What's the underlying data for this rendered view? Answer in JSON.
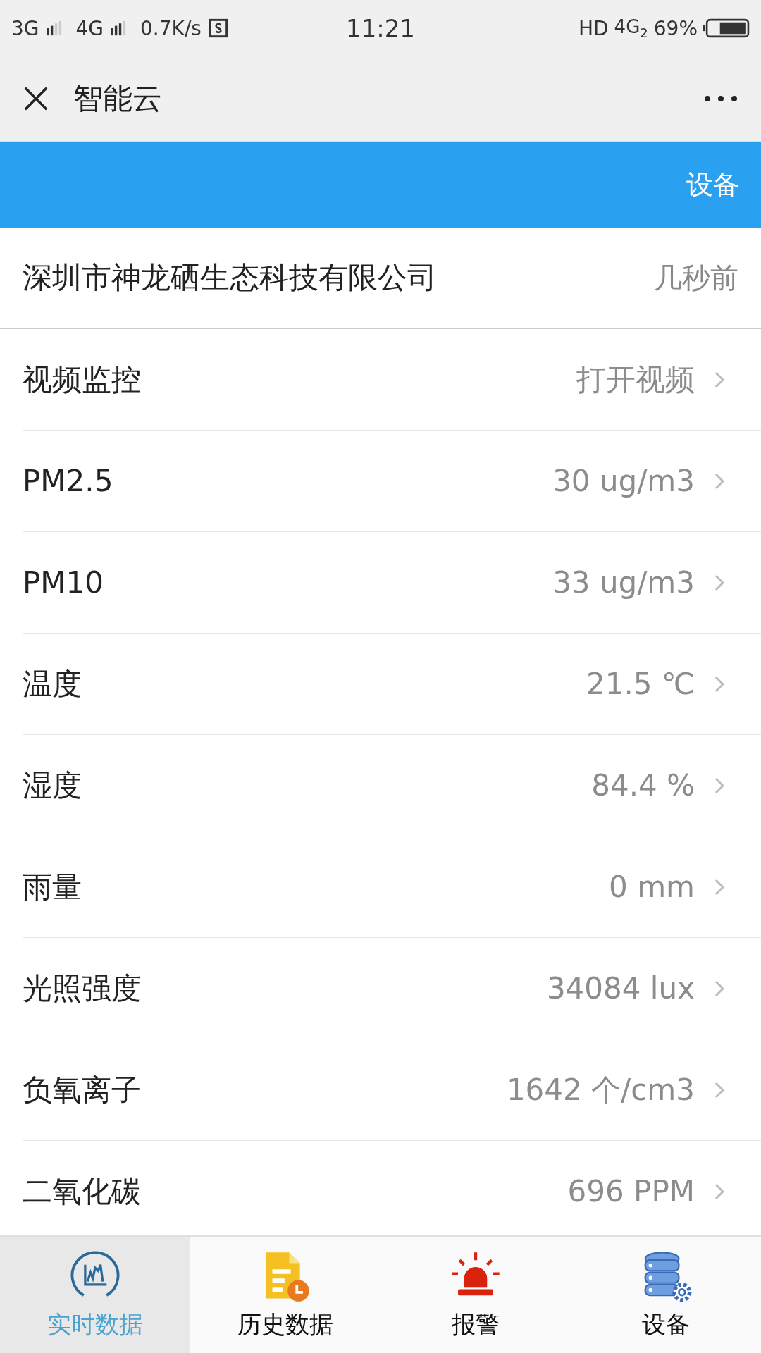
{
  "status_bar": {
    "network_1": "3G",
    "network_2": "4G",
    "speed": "0.7K/s",
    "time": "11:21",
    "hd": "HD",
    "network_3": "4G",
    "sim": "2",
    "battery": "69%"
  },
  "nav_bar": {
    "title": "智能云"
  },
  "header": {
    "action": "设备"
  },
  "company": {
    "name": "深圳市神龙硒生态科技有限公司",
    "updated": "几秒前"
  },
  "rows": [
    {
      "label": "视频监控",
      "value": "打开视频"
    },
    {
      "label": "PM2.5",
      "value": "30 ug/m3"
    },
    {
      "label": "PM10",
      "value": "33 ug/m3"
    },
    {
      "label": "温度",
      "value": "21.5 ℃"
    },
    {
      "label": "湿度",
      "value": "84.4 %"
    },
    {
      "label": "雨量",
      "value": "0 mm"
    },
    {
      "label": "光照强度",
      "value": "34084 lux"
    },
    {
      "label": "负氧离子",
      "value": "1642 个/cm3"
    },
    {
      "label": "二氧化碳",
      "value": "696 PPM"
    }
  ],
  "tabs": [
    {
      "kind": "chart",
      "label": "实时数据",
      "selected": true
    },
    {
      "kind": "history",
      "label": "历史数据",
      "selected": false
    },
    {
      "kind": "alarm",
      "label": "报警",
      "selected": false
    },
    {
      "kind": "device",
      "label": "设备",
      "selected": false
    }
  ]
}
